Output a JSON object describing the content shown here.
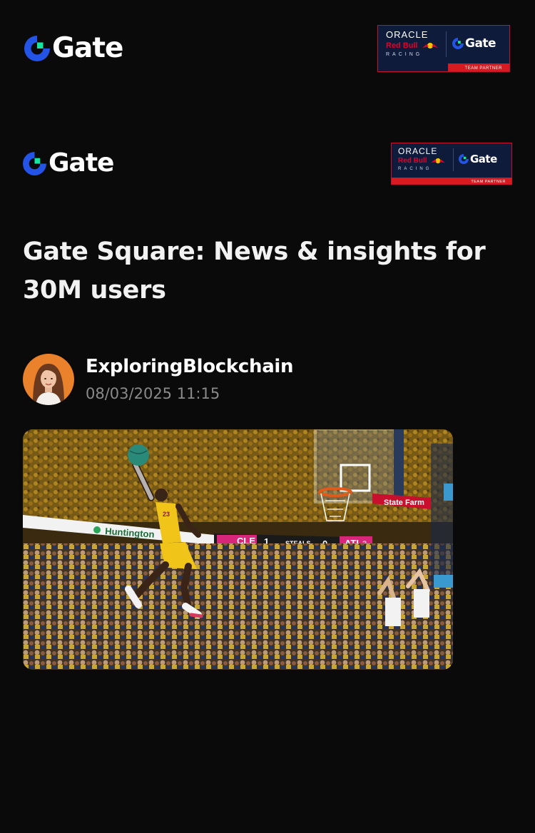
{
  "brand": {
    "name": "Gate",
    "logo_icon": "gate-logo-icon",
    "colors": {
      "logo_blue": "#2354e6",
      "logo_green": "#17e6a1",
      "background": "#0a0a0a",
      "badge_navy": "#0f1b3a",
      "badge_red": "#d71920"
    }
  },
  "partner_badge": {
    "oracle": "ORACLE",
    "redbull": "Red Bull",
    "racing": "RACING",
    "gate": "Gate",
    "partner_label": "TEAM PARTNER"
  },
  "post": {
    "title": "Gate Square: News & insights for 30M users",
    "author": {
      "name": "ExploringBlockchain",
      "timestamp": "08/03/2025 11:15",
      "avatar_icon": "user-avatar"
    },
    "media": {
      "scoreboard": {
        "team_left": "CLE",
        "score_left": "1",
        "stat_label": "STEALS",
        "score_right": "0",
        "team_right": "ATL",
        "right_suffix": "3"
      },
      "banner_text": "Huntington",
      "sponsor_text": "State Farm"
    }
  }
}
